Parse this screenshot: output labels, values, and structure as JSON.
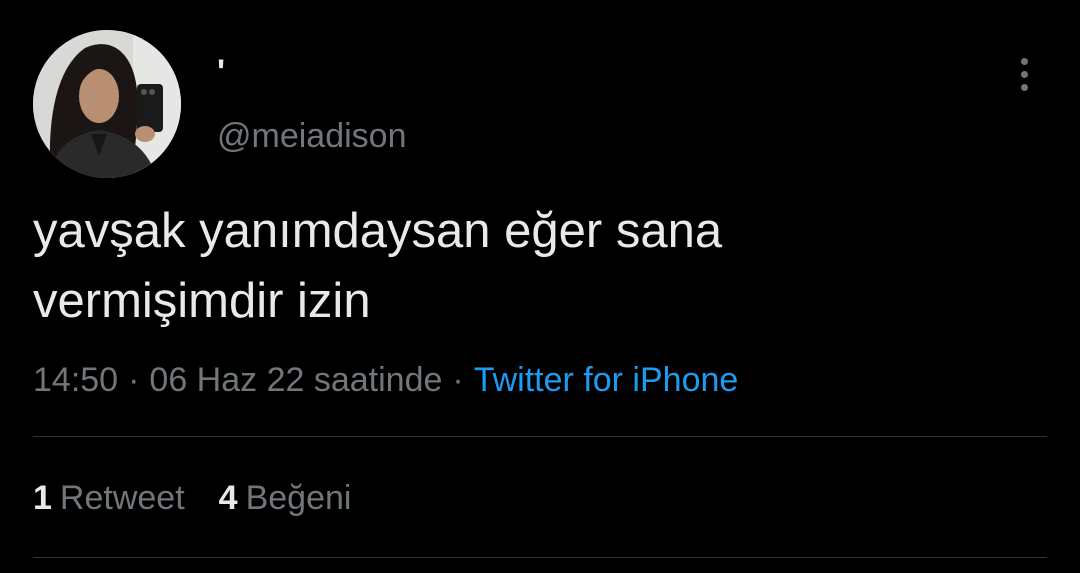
{
  "author": {
    "display_name": "'",
    "handle": "@meiadison",
    "avatar": "profile-photo"
  },
  "tweet": {
    "text_line1": "yavşak yanımdaysan eğer sana",
    "text_line2": "vermişimdir izin"
  },
  "meta": {
    "time": "14:50",
    "separator": "·",
    "date": "06 Haz 22 saatinde",
    "source": "Twitter for iPhone"
  },
  "stats": {
    "retweets_count": "1",
    "retweets_label": "Retweet",
    "likes_count": "4",
    "likes_label": "Beğeni"
  },
  "icons": {
    "more": "more-options-icon"
  },
  "colors": {
    "background": "#000000",
    "primary_text": "#e7e9ea",
    "secondary_text": "#71767b",
    "link": "#1d9bf0",
    "divider": "#2f3336"
  }
}
